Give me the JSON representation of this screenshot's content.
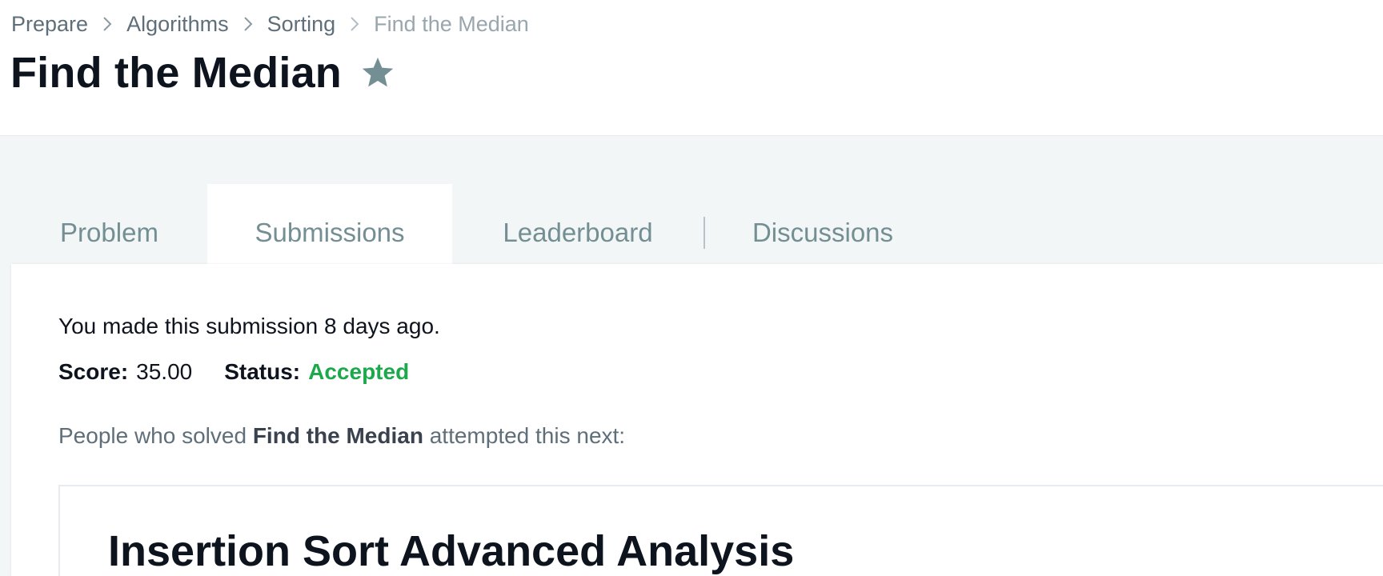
{
  "breadcrumb": {
    "items": [
      "Prepare",
      "Algorithms",
      "Sorting",
      "Find the Median"
    ]
  },
  "page": {
    "title": "Find the Median",
    "star_icon": "star-icon"
  },
  "tabs": [
    {
      "label": "Problem",
      "active": false
    },
    {
      "label": "Submissions",
      "active": true
    },
    {
      "label": "Leaderboard",
      "active": false
    },
    {
      "label": "Discussions",
      "active": false
    }
  ],
  "submission": {
    "made_text": "You made this submission 8 days ago.",
    "score_label": "Score:",
    "score_value": "35.00",
    "status_label": "Status:",
    "status_value": "Accepted"
  },
  "next": {
    "prefix": "People who solved ",
    "challenge_name": "Find the Median",
    "suffix": " attempted this next:",
    "title": "Insertion Sort Advanced Analysis"
  },
  "colors": {
    "accepted": "#1ba94c",
    "tab_text": "#738f93",
    "title": "#0e141e",
    "band": "#f3f6f7",
    "star": "#738f93"
  }
}
